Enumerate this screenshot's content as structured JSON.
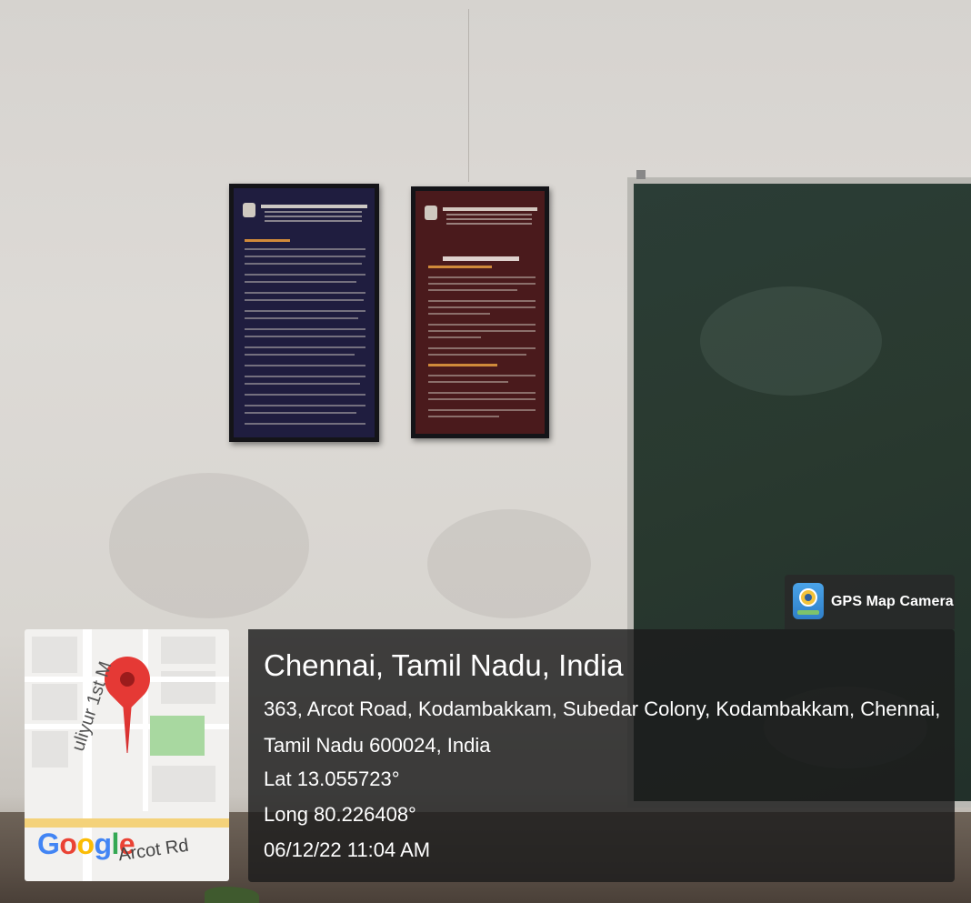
{
  "photo": {
    "description_hidden": true
  },
  "gps_badge": {
    "label": "GPS Map Camera",
    "icon": "gps-map-camera-icon"
  },
  "location": {
    "city": "Chennai, Tamil Nadu, India",
    "address_line1": "363, Arcot Road, Kodambakkam, Subedar Colony, Kodambakkam, Chennai,",
    "address_line2": "Tamil Nadu 600024, India",
    "lat": "Lat 13.055723°",
    "long": "Long 80.226408°",
    "datetime": "06/12/22 11:04 AM"
  },
  "map": {
    "street_label": "uliyur 1st M",
    "road_label": "Arcot Rd",
    "logo_parts": [
      "G",
      "o",
      "o",
      "g",
      "l",
      "e"
    ],
    "pin_icon": "map-pin-icon"
  },
  "colors": {
    "pin": "#e53935",
    "panel_bg": "#1c1c1c",
    "board": "#29392f"
  }
}
